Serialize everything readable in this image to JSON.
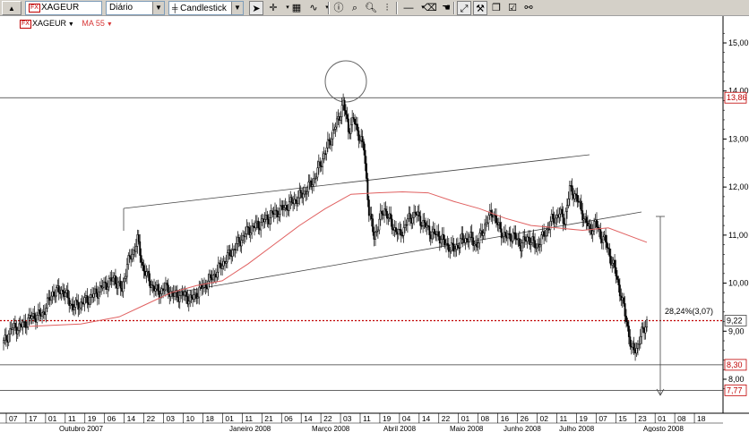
{
  "toolbar": {
    "symbol": "XAGEUR",
    "symbol_badge": "FX",
    "period": "Diário",
    "chart_type": "Candlestick"
  },
  "legend": {
    "ticker_badge": "FX",
    "ticker": "XAGEUR",
    "ma_label": "MA 55"
  },
  "colors": {
    "ma_line": "#e06060",
    "level_marker_red": "#c00000",
    "candle": "#000000"
  },
  "chart_data": {
    "type": "candlestick",
    "price_axis": {
      "range": [
        7.6,
        15.3
      ],
      "ticks": [
        "15,00",
        "14,00",
        "13,00",
        "12,00",
        "11,00",
        "10,00",
        "9,00",
        "8,00"
      ]
    },
    "level_labels": [
      {
        "text": "13,86",
        "value": 13.86,
        "style": "red"
      },
      {
        "text": "9,22",
        "value": 9.22,
        "style": "dark"
      },
      {
        "text": "8,30",
        "value": 8.3,
        "style": "red"
      },
      {
        "text": "7,77",
        "value": 7.77,
        "style": "red"
      }
    ],
    "annotation": "28,24%(3,07)",
    "date_ticks": [
      "07",
      "17",
      "01",
      "11",
      "19",
      "06",
      "14",
      "22",
      "03",
      "10",
      "18",
      "01",
      "11",
      "21",
      "06",
      "14",
      "22",
      "03",
      "11",
      "19",
      "04",
      "14",
      "22",
      "01",
      "08",
      "16",
      "26",
      "02",
      "11",
      "19",
      "07",
      "15",
      "23",
      "01",
      "08",
      "18"
    ],
    "month_labels": [
      "Outubro 2007",
      "Janeiro 2008",
      "Março 2008",
      "Abril 2008",
      "Maio 2008",
      "Junho 2008",
      "Julho 2008",
      "Agosto 2008"
    ],
    "price_anchors": [
      [
        0,
        8.75
      ],
      [
        6,
        9.05
      ],
      [
        14,
        9.1
      ],
      [
        22,
        9.3
      ],
      [
        30,
        9.35
      ],
      [
        38,
        9.8
      ],
      [
        46,
        9.85
      ],
      [
        54,
        9.5
      ],
      [
        62,
        9.6
      ],
      [
        70,
        9.75
      ],
      [
        78,
        9.95
      ],
      [
        86,
        10.1
      ],
      [
        92,
        9.85
      ],
      [
        96,
        10.4
      ],
      [
        100,
        10.6
      ],
      [
        104,
        10.9
      ],
      [
        108,
        10.35
      ],
      [
        114,
        10.0
      ],
      [
        120,
        9.8
      ],
      [
        126,
        9.9
      ],
      [
        132,
        9.75
      ],
      [
        140,
        9.75
      ],
      [
        146,
        9.65
      ],
      [
        152,
        9.85
      ],
      [
        160,
        10.05
      ],
      [
        170,
        10.4
      ],
      [
        180,
        10.75
      ],
      [
        190,
        11.1
      ],
      [
        200,
        11.25
      ],
      [
        210,
        11.45
      ],
      [
        220,
        11.6
      ],
      [
        230,
        11.8
      ],
      [
        236,
        11.95
      ],
      [
        242,
        12.2
      ],
      [
        248,
        12.6
      ],
      [
        254,
        13.0
      ],
      [
        260,
        13.4
      ],
      [
        264,
        13.75
      ],
      [
        268,
        13.2
      ],
      [
        272,
        13.4
      ],
      [
        276,
        13.1
      ],
      [
        280,
        12.8
      ],
      [
        284,
        11.5
      ],
      [
        288,
        10.95
      ],
      [
        292,
        11.3
      ],
      [
        296,
        11.55
      ],
      [
        302,
        11.2
      ],
      [
        308,
        11.0
      ],
      [
        314,
        11.3
      ],
      [
        320,
        11.45
      ],
      [
        326,
        11.25
      ],
      [
        332,
        11.05
      ],
      [
        338,
        11.0
      ],
      [
        344,
        10.8
      ],
      [
        350,
        10.7
      ],
      [
        356,
        10.9
      ],
      [
        362,
        10.95
      ],
      [
        368,
        10.8
      ],
      [
        374,
        11.2
      ],
      [
        380,
        11.5
      ],
      [
        384,
        11.2
      ],
      [
        390,
        10.95
      ],
      [
        396,
        11.0
      ],
      [
        402,
        10.8
      ],
      [
        408,
        10.95
      ],
      [
        414,
        10.75
      ],
      [
        420,
        11.0
      ],
      [
        426,
        11.3
      ],
      [
        432,
        11.45
      ],
      [
        436,
        11.3
      ],
      [
        440,
        11.95
      ],
      [
        444,
        11.85
      ],
      [
        448,
        11.6
      ],
      [
        452,
        11.3
      ],
      [
        456,
        11.1
      ],
      [
        460,
        11.25
      ],
      [
        464,
        11.0
      ],
      [
        468,
        10.85
      ],
      [
        472,
        10.5
      ],
      [
        476,
        10.2
      ],
      [
        480,
        9.7
      ],
      [
        484,
        9.25
      ],
      [
        488,
        8.6
      ],
      [
        492,
        8.65
      ],
      [
        496,
        8.95
      ],
      [
        500,
        9.2
      ]
    ],
    "moving_average": [
      [
        20,
        9.1
      ],
      [
        60,
        9.15
      ],
      [
        90,
        9.3
      ],
      [
        110,
        9.55
      ],
      [
        130,
        9.8
      ],
      [
        150,
        9.95
      ],
      [
        170,
        10.05
      ],
      [
        190,
        10.4
      ],
      [
        210,
        10.8
      ],
      [
        230,
        11.2
      ],
      [
        250,
        11.55
      ],
      [
        270,
        11.85
      ],
      [
        290,
        11.88
      ],
      [
        310,
        11.9
      ],
      [
        330,
        11.88
      ],
      [
        350,
        11.7
      ],
      [
        370,
        11.55
      ],
      [
        390,
        11.35
      ],
      [
        410,
        11.2
      ],
      [
        430,
        11.15
      ],
      [
        450,
        11.1
      ],
      [
        470,
        11.15
      ],
      [
        490,
        10.95
      ],
      [
        500,
        10.85
      ]
    ]
  }
}
